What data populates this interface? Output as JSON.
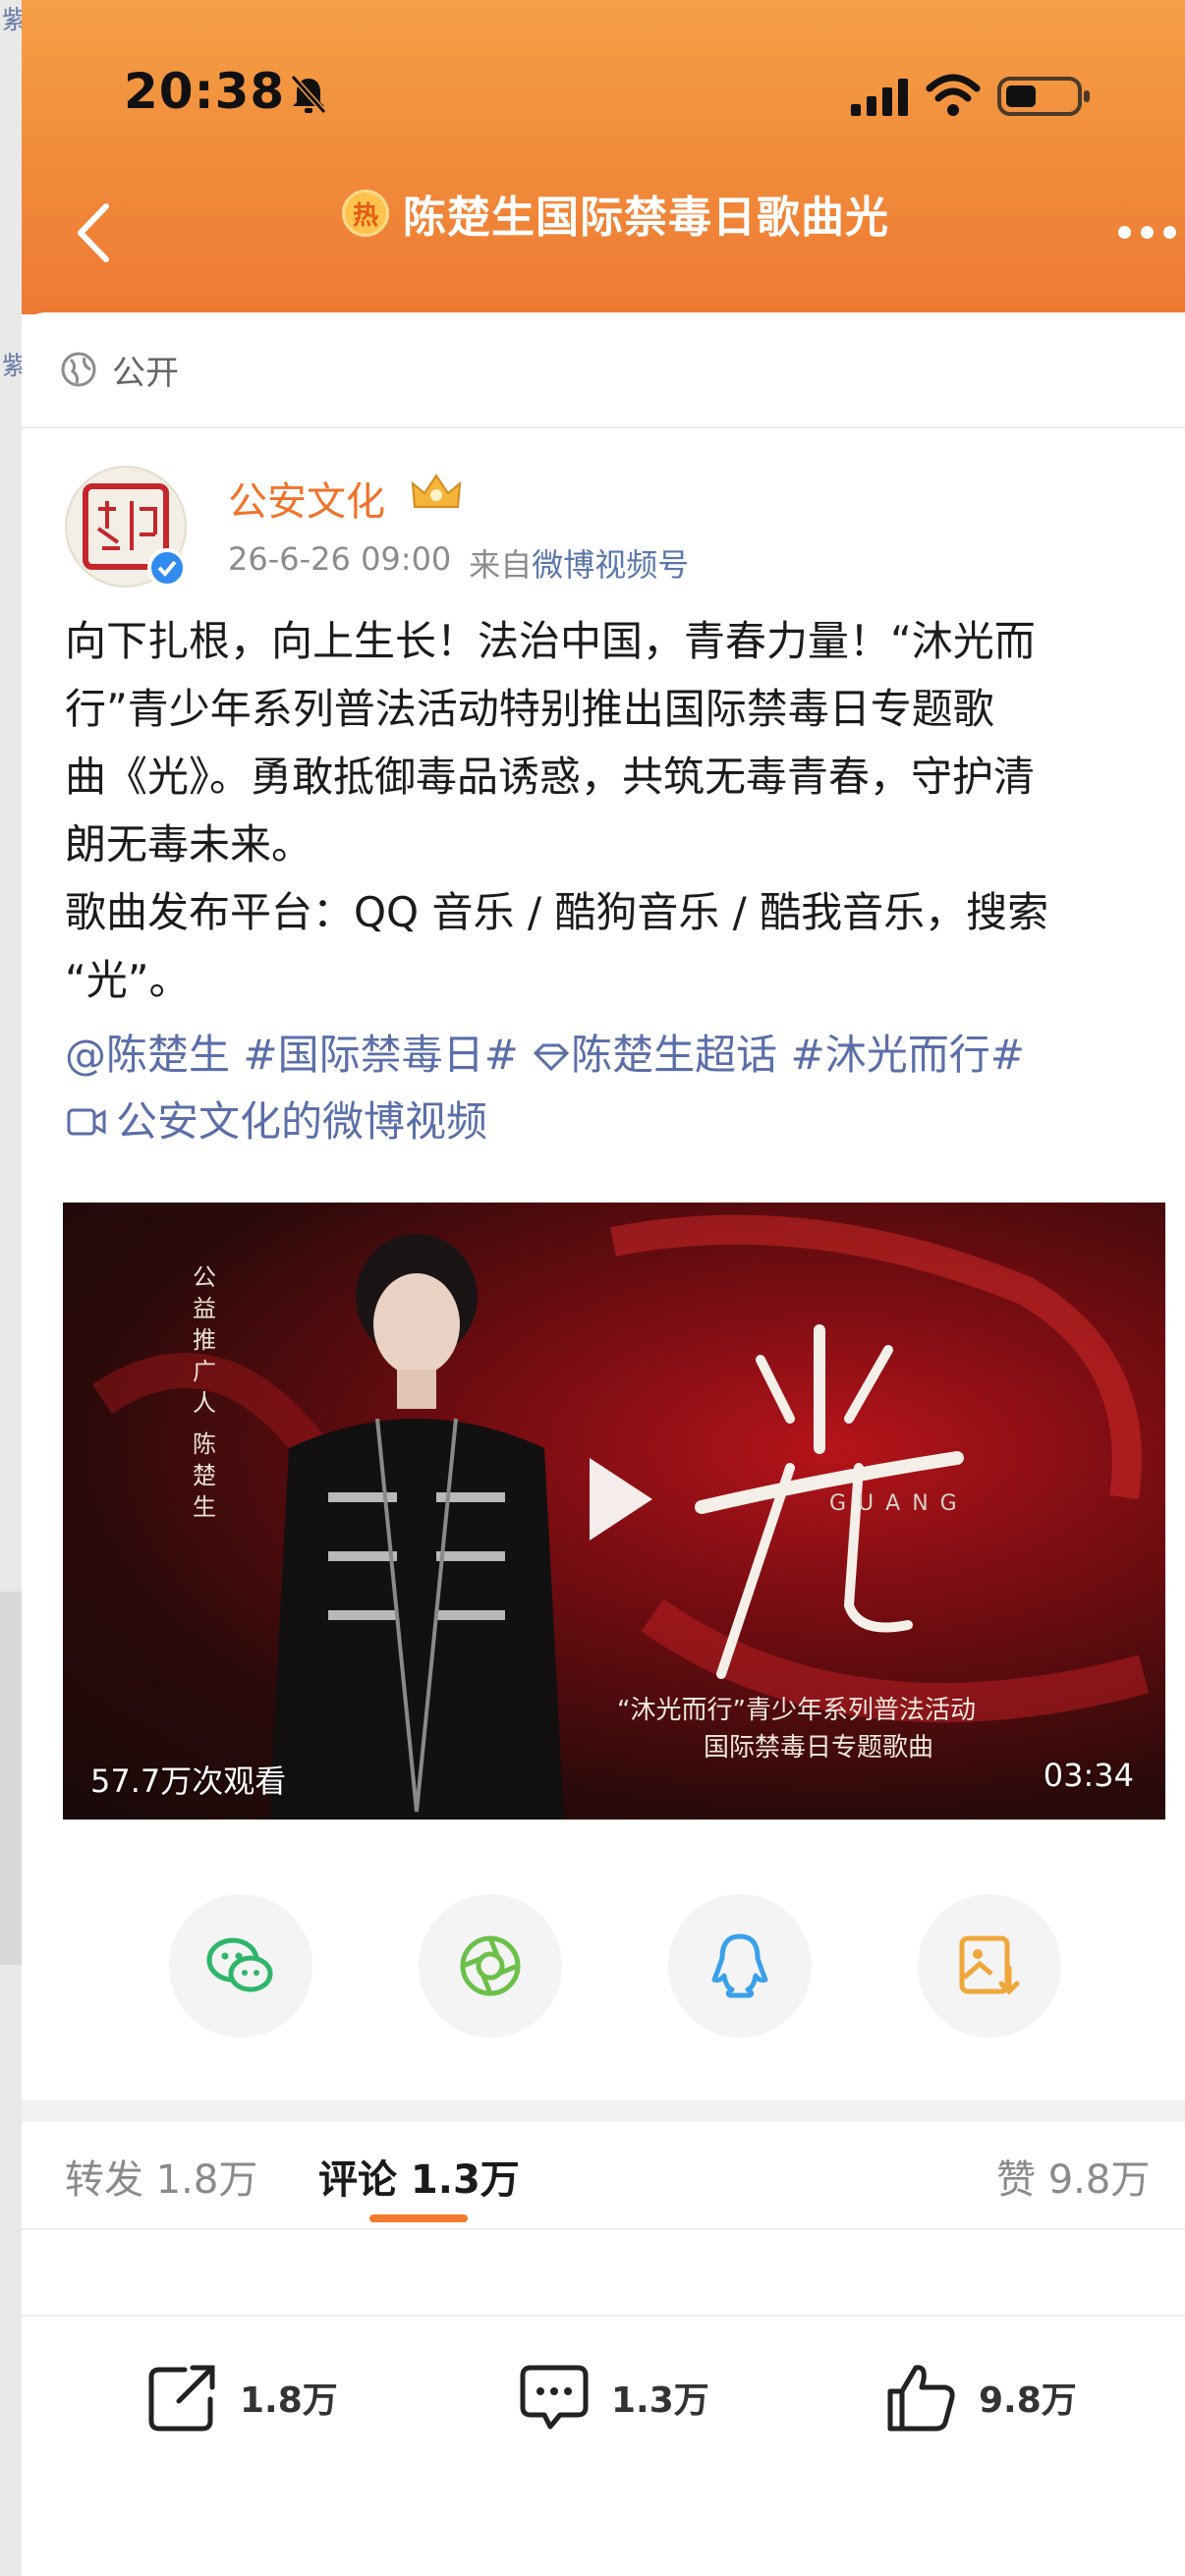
{
  "status_bar": {
    "time": "20:38"
  },
  "header": {
    "title": "陈楚生国际禁毒日歌曲光",
    "hot_badge": "热"
  },
  "post": {
    "visibility": "公开",
    "author": "公安文化",
    "date": "26-6-26 09:00",
    "source_prefix": "来自",
    "source": "微博视频号",
    "text_lines": [
      "向下扎根，向上生长！法治中国，青春力量！“沐光而",
      "行”青少年系列普法活动特别推出国际禁毒日专题歌",
      "曲《光》。勇敢抵御毒品诱惑，共筑无毒青春，守护清",
      "朗无毒未来。",
      "歌曲发布平台：QQ 音乐 / 酷狗音乐 / 酷我音乐，搜索",
      "“光”。"
    ],
    "tags": {
      "mention": "@陈楚生",
      "topic1": "#国际禁毒日#",
      "super_topic": "陈楚生超话",
      "topic2": "#沐光而行#",
      "video_link": "公安文化的微博视频"
    }
  },
  "video": {
    "vertical_text_1": "公益推广人",
    "vertical_text_2": "陈楚生",
    "calligraphy_title": "光",
    "title_romanization": "GUANG",
    "subtitle_1": "“沐光而行”青少年系列普法活动",
    "subtitle_2": "国际禁毒日专题歌曲",
    "views": "57.7万次观看",
    "duration": "03:34"
  },
  "share_buttons": [
    "wechat-icon",
    "moments-icon",
    "qq-icon",
    "save-image-icon"
  ],
  "tabs": {
    "repost": "转发 1.8万",
    "comment": "评论 1.3万",
    "like": "赞 9.8万"
  },
  "actions": {
    "repost_count": "1.8万",
    "comment_count": "1.3万",
    "like_count": "9.8万"
  },
  "left_peek": {
    "text_1": "紫",
    "text_2": "紫"
  },
  "colors": {
    "accent": "#f27a2c",
    "link": "#5b6ea8",
    "header_top": "#f5a046"
  }
}
